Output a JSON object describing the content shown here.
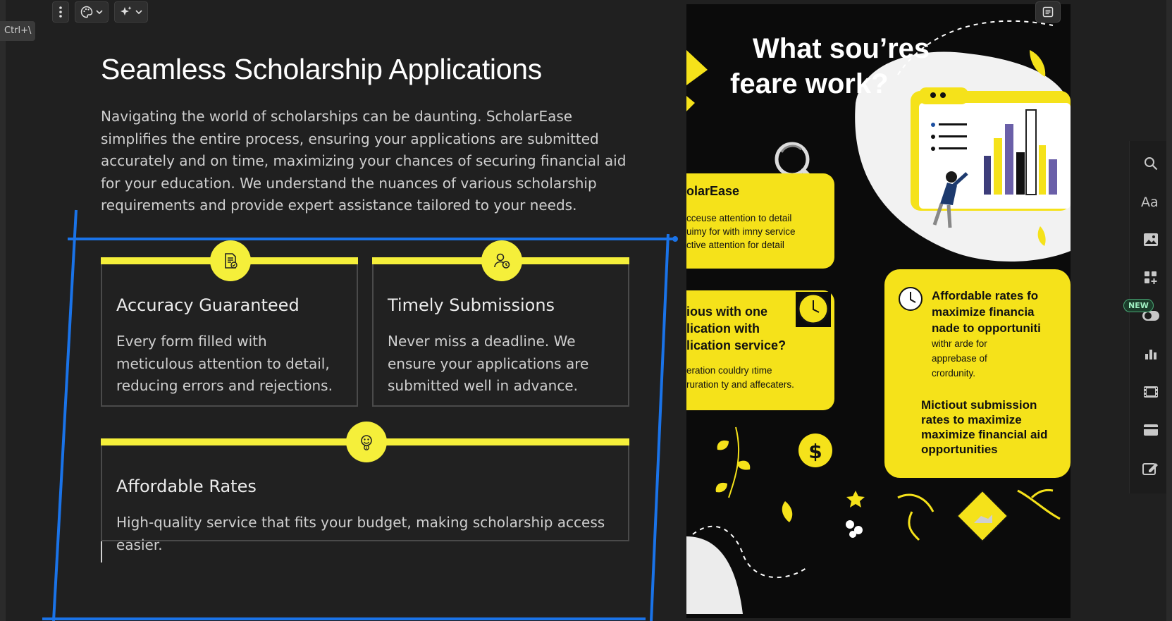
{
  "shortcut_hint": "Ctrl+\\",
  "toolbar": {
    "more_icon": "more-vertical-icon",
    "theme_icon": "palette-icon",
    "ai_icon": "sparkles-icon"
  },
  "section": {
    "title": "Seamless Scholarship Applications",
    "intro": "Navigating the world of scholarships can be daunting. ScholarEase simplifies the entire process, ensuring your applications are submitted accurately and on time, maximizing your chances of securing financial aid for your education. We understand the nuances of various scholarship requirements and provide expert assistance tailored to your needs."
  },
  "cards": [
    {
      "title": "Accuracy Guaranteed",
      "text": "Every form filled with meticulous attention to detail, reducing errors and rejections.",
      "icon": "document-check-icon"
    },
    {
      "title": "Timely Submissions",
      "text": "Never miss a deadline. We ensure your applications are submitted well in advance.",
      "icon": "user-clock-icon"
    },
    {
      "title": "Affordable Rates",
      "text": "High-quality service that fits your budget, making scholarship access easier.",
      "icon": "money-face-icon"
    }
  ],
  "preview": {
    "heading_line1": "What sou’res",
    "heading_line2": "feare work?",
    "box1_title": "olarEase",
    "box1_lines": [
      "cceuse attention to detail",
      "uimy for with imny service",
      "ctive attention for detail"
    ],
    "box2_title_lines": [
      "ious with one",
      "lication with",
      "lication service?"
    ],
    "box2_lines": [
      "eration couldry ıtime",
      "ruration ty and affecaters."
    ],
    "box3_title_lines": [
      "Affordable rates fo",
      "maximize financia",
      "nade to opportuniti"
    ],
    "box3_lines": [
      "withr arde for",
      "apprebase of",
      "crordunity."
    ],
    "box3_bold_lines": [
      "Mictiout submission",
      "rates to maximize",
      "maximize financial aid",
      "opportunities"
    ]
  },
  "right_rail": {
    "icons": [
      "search-icon",
      "text-style-icon",
      "image-icon",
      "add-widget-icon",
      "toggle-icon",
      "chart-icon",
      "film-icon",
      "card-icon",
      "edit-icon"
    ],
    "new_badge": "NEW"
  },
  "colors": {
    "accent_yellow": "#f5ef3a",
    "frame_blue": "#1a73e8"
  }
}
